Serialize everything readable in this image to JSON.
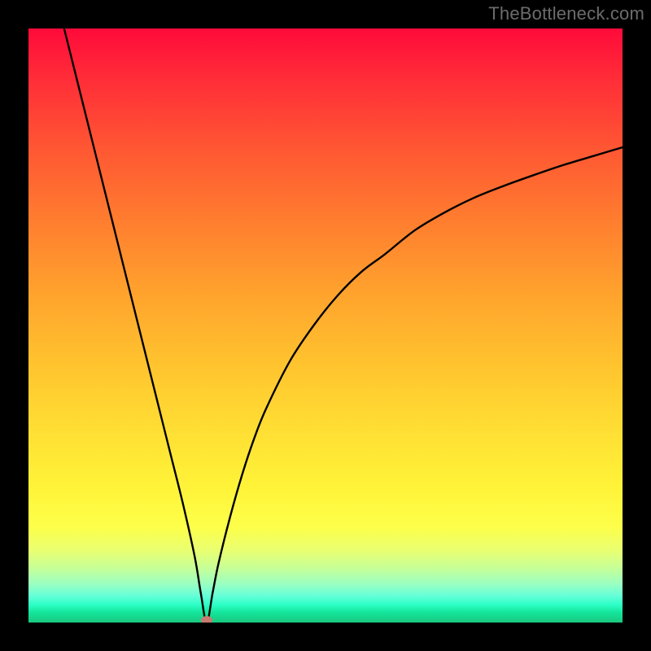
{
  "watermark": "TheBottleneck.com",
  "colors": {
    "frame": "#000000",
    "curve": "#000000",
    "dot": "#c97a70",
    "watermark": "#6c6c6c"
  },
  "chart_data": {
    "type": "line",
    "title": "",
    "xlabel": "",
    "ylabel": "",
    "xlim": [
      0,
      100
    ],
    "ylim": [
      0,
      100
    ],
    "grid": false,
    "curve": {
      "description": "V-shaped bottleneck curve with minimum near x≈30; left branch falls steeply from top, right branch rises with diminishing slope toward ~80%",
      "min_x": 30,
      "min_y": 0,
      "left_branch_start": {
        "x": 6,
        "y": 100
      },
      "right_branch_end": {
        "x": 100,
        "y": 80
      },
      "x": [
        6,
        8,
        10,
        12,
        14,
        16,
        18,
        20,
        22,
        24,
        26,
        28,
        29,
        30,
        31,
        32,
        34,
        36,
        38,
        40,
        44,
        48,
        52,
        56,
        60,
        65,
        70,
        75,
        80,
        85,
        90,
        95,
        100
      ],
      "y": [
        100,
        92,
        84,
        76,
        68,
        60,
        52,
        44,
        36,
        28,
        20,
        11,
        5,
        0,
        5,
        10,
        18,
        25,
        31,
        36,
        44,
        50,
        55,
        59,
        62,
        66,
        69,
        71.5,
        73.5,
        75.3,
        77,
        78.5,
        80
      ]
    },
    "marker": {
      "x": 30,
      "y": 0
    },
    "background_gradient": {
      "orientation": "vertical",
      "stops": [
        {
          "pos": 0.0,
          "color": "#ff0a3a"
        },
        {
          "pos": 0.2,
          "color": "#ff5633"
        },
        {
          "pos": 0.44,
          "color": "#ffa12d"
        },
        {
          "pos": 0.67,
          "color": "#ffdd33"
        },
        {
          "pos": 0.84,
          "color": "#fdff4a"
        },
        {
          "pos": 0.93,
          "color": "#9affc1"
        },
        {
          "pos": 1.0,
          "color": "#19c87f"
        }
      ]
    }
  }
}
